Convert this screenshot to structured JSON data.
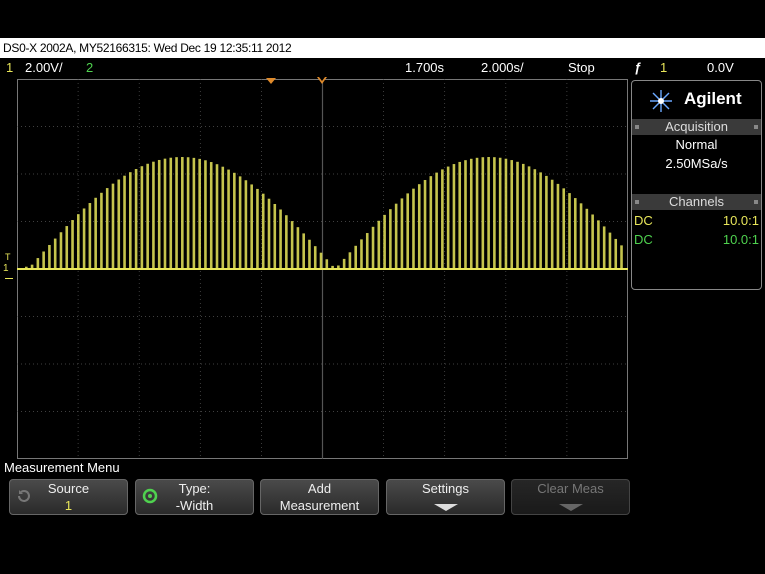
{
  "title": "DS0-X 2002A, MY52166315: Wed Dec 19 12:35:11 2012",
  "status": {
    "ch1_label": "1",
    "ch1_scale": "2.00V/",
    "ch2_label": "2",
    "time_delay": "1.700s",
    "time_scale": "2.000s/",
    "run_state": "Stop",
    "trigger_icon": "trigger-edge-icon",
    "trigger_source": "1",
    "trigger_level": "0.0V"
  },
  "colors": {
    "ch1": "#e8e65a",
    "ch2": "#4fd24f",
    "grid": "#555555"
  },
  "screen": {
    "ground_marker": "1",
    "trigger_marker": "T"
  },
  "sidebar": {
    "brand": "Agilent",
    "acquisition_header": "Acquisition",
    "acquisition_mode": "Normal",
    "sample_rate": "2.50MSa/s",
    "channels_header": "Channels",
    "channels": [
      {
        "coupling": "DC",
        "probe": "10.0:1"
      },
      {
        "coupling": "DC",
        "probe": "10.0:1"
      }
    ]
  },
  "menu": {
    "title": "Measurement Menu",
    "softkeys": [
      {
        "line1": "Source",
        "line2": "1"
      },
      {
        "line1": "Type:",
        "line2": "-Width"
      },
      {
        "line1": "Add",
        "line2": "Measurement"
      },
      {
        "line1": "Settings",
        "line2": ""
      },
      {
        "line1": "Clear Meas",
        "line2": ""
      }
    ]
  }
}
